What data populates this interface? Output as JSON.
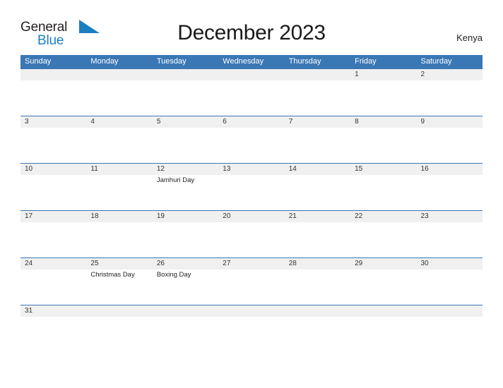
{
  "brand": {
    "name_part1": "General",
    "name_part2": "Blue",
    "flag_icon": "blue-flag-triangle",
    "color_dark": "#231f20",
    "color_blue": "#1a7fc1"
  },
  "header": {
    "title": "December 2023",
    "locale": "Kenya"
  },
  "theme": {
    "header_blue": "#3a77b5",
    "row_divider_blue": "#3a77b5",
    "date_band_gray": "#f0f0f0",
    "text_dark": "#333333"
  },
  "calendar": {
    "month": "December",
    "year": "2023",
    "country": "Kenya",
    "weekday_headers": [
      "Sunday",
      "Monday",
      "Tuesday",
      "Wednesday",
      "Thursday",
      "Friday",
      "Saturday"
    ],
    "weeks": [
      {
        "days": [
          {
            "date": "",
            "event": ""
          },
          {
            "date": "",
            "event": ""
          },
          {
            "date": "",
            "event": ""
          },
          {
            "date": "",
            "event": ""
          },
          {
            "date": "",
            "event": ""
          },
          {
            "date": "1",
            "event": ""
          },
          {
            "date": "2",
            "event": ""
          }
        ]
      },
      {
        "days": [
          {
            "date": "3",
            "event": ""
          },
          {
            "date": "4",
            "event": ""
          },
          {
            "date": "5",
            "event": ""
          },
          {
            "date": "6",
            "event": ""
          },
          {
            "date": "7",
            "event": ""
          },
          {
            "date": "8",
            "event": ""
          },
          {
            "date": "9",
            "event": ""
          }
        ]
      },
      {
        "days": [
          {
            "date": "10",
            "event": ""
          },
          {
            "date": "11",
            "event": ""
          },
          {
            "date": "12",
            "event": "Jamhuri Day"
          },
          {
            "date": "13",
            "event": ""
          },
          {
            "date": "14",
            "event": ""
          },
          {
            "date": "15",
            "event": ""
          },
          {
            "date": "16",
            "event": ""
          }
        ]
      },
      {
        "days": [
          {
            "date": "17",
            "event": ""
          },
          {
            "date": "18",
            "event": ""
          },
          {
            "date": "19",
            "event": ""
          },
          {
            "date": "20",
            "event": ""
          },
          {
            "date": "21",
            "event": ""
          },
          {
            "date": "22",
            "event": ""
          },
          {
            "date": "23",
            "event": ""
          }
        ]
      },
      {
        "days": [
          {
            "date": "24",
            "event": ""
          },
          {
            "date": "25",
            "event": "Christmas Day"
          },
          {
            "date": "26",
            "event": "Boxing Day"
          },
          {
            "date": "27",
            "event": ""
          },
          {
            "date": "28",
            "event": ""
          },
          {
            "date": "29",
            "event": ""
          },
          {
            "date": "30",
            "event": ""
          }
        ]
      },
      {
        "days": [
          {
            "date": "31",
            "event": ""
          },
          {
            "date": "",
            "event": ""
          },
          {
            "date": "",
            "event": ""
          },
          {
            "date": "",
            "event": ""
          },
          {
            "date": "",
            "event": ""
          },
          {
            "date": "",
            "event": ""
          },
          {
            "date": "",
            "event": ""
          }
        ]
      }
    ]
  }
}
